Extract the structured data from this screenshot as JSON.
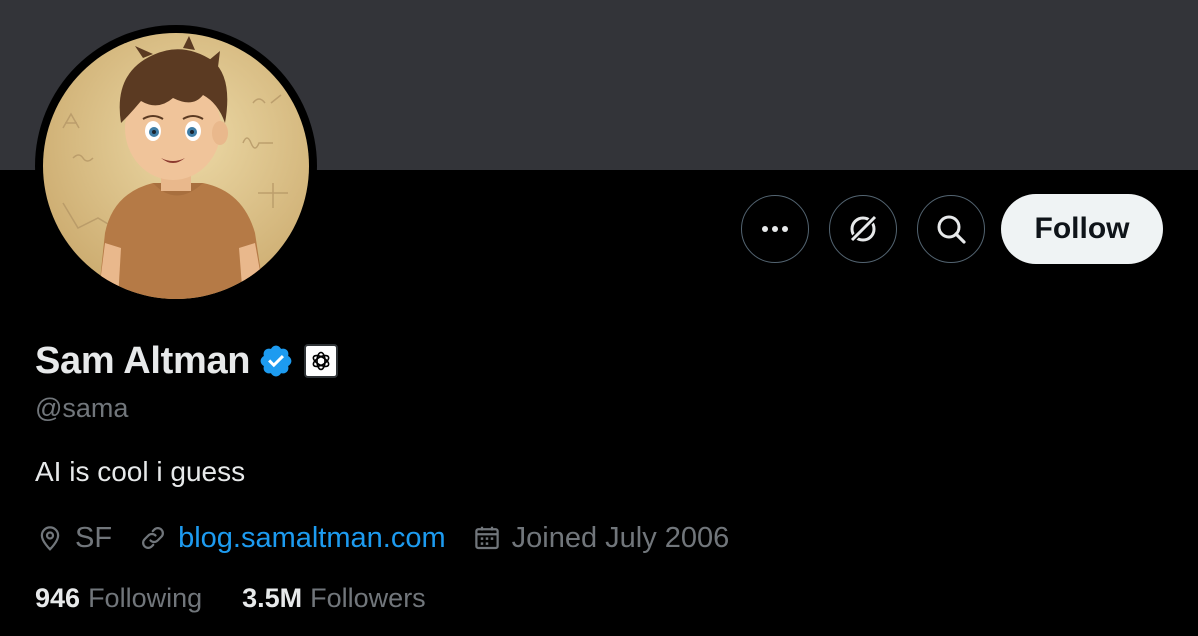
{
  "profile": {
    "name": "Sam Altman",
    "handle": "@sama",
    "bio": "AI is cool i guess",
    "location": "SF",
    "website": "blog.samaltman.com",
    "joined": "Joined July 2006",
    "following_count": "946",
    "following_label": "Following",
    "followers_count": "3.5M",
    "followers_label": "Followers"
  },
  "actions": {
    "follow_label": "Follow",
    "more_icon": "ellipsis-icon",
    "grok_icon": "grok-icon",
    "search_icon": "search-icon"
  },
  "colors": {
    "banner": "#333439",
    "background": "#000000",
    "verified": "#1d9bf0",
    "link": "#1d9bf0",
    "secondary_text": "#71767b",
    "primary_text": "#e7e9ea"
  }
}
